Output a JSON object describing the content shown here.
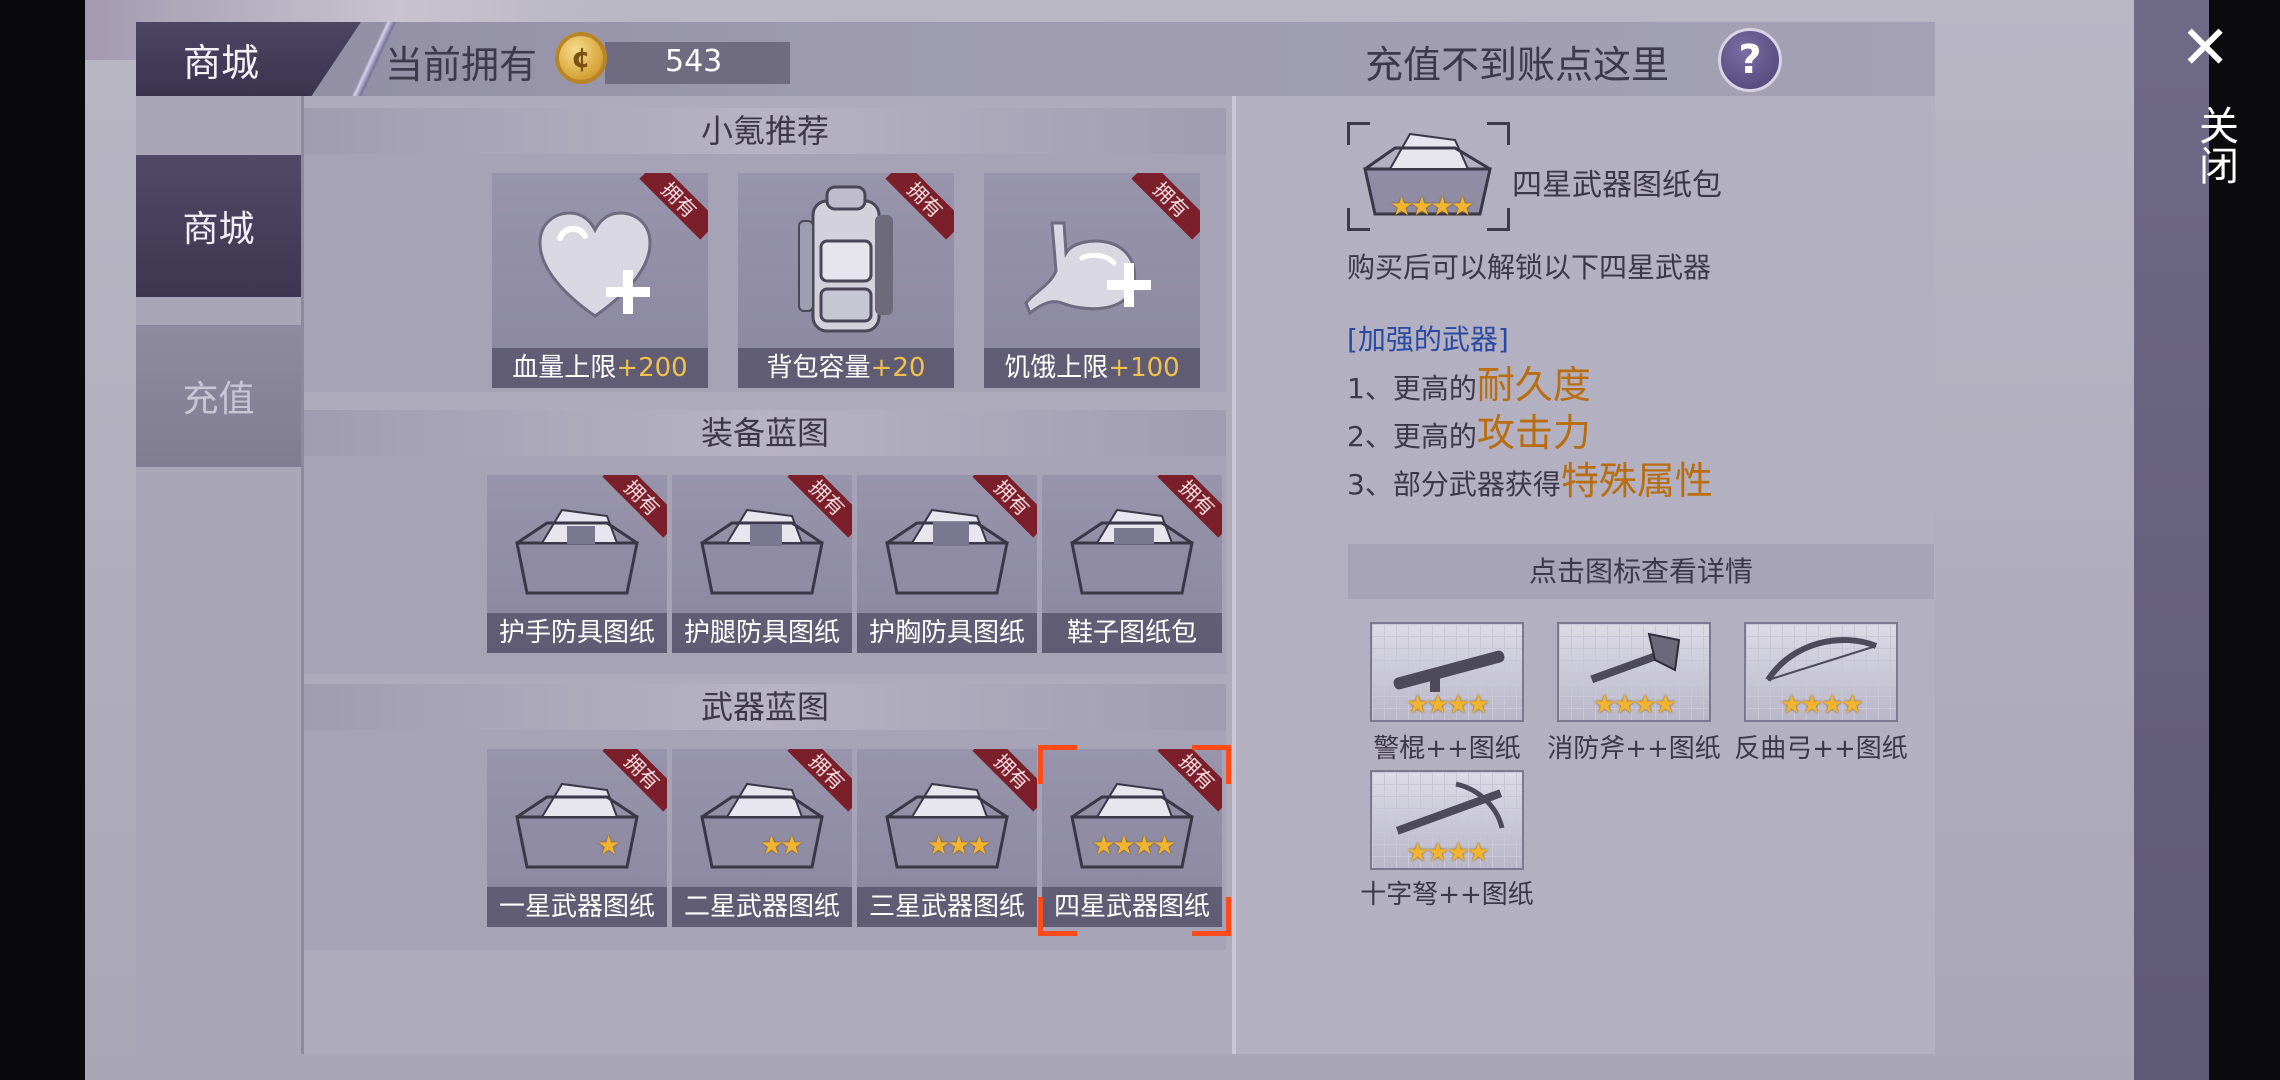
{
  "header": {
    "shop_tab": "商城",
    "owned_label": "当前拥有",
    "coin_glyph": "¢",
    "coin_value": "543",
    "recharge_help": "充值不到账点这里",
    "help_glyph": "?"
  },
  "nav": {
    "items": [
      {
        "label": "商城",
        "active": true
      },
      {
        "label": "充值",
        "active": false
      }
    ]
  },
  "sections": [
    {
      "title": "小氪推荐"
    },
    {
      "title": "装备蓝图"
    },
    {
      "title": "武器蓝图"
    }
  ],
  "owned_badge": "拥有",
  "recommend": [
    {
      "name": "血量上限",
      "bonus": "+200",
      "icon": "heart-plus-icon"
    },
    {
      "name": "背包容量",
      "bonus": "+20",
      "icon": "backpack-icon"
    },
    {
      "name": "饥饿上限",
      "bonus": "+100",
      "icon": "stomach-plus-icon"
    }
  ],
  "equipment": [
    {
      "name": "护手防具图纸",
      "icon": "toolbox-blueprint-icon"
    },
    {
      "name": "护腿防具图纸",
      "icon": "toolbox-blueprint-icon"
    },
    {
      "name": "护胸防具图纸",
      "icon": "toolbox-blueprint-icon"
    },
    {
      "name": "鞋子图纸包",
      "icon": "toolbox-blueprint-icon"
    }
  ],
  "weapons": [
    {
      "name": "一星武器图纸",
      "stars": "★"
    },
    {
      "name": "二星武器图纸",
      "stars": "★★"
    },
    {
      "name": "三星武器图纸",
      "stars": "★★★"
    },
    {
      "name": "四星武器图纸",
      "stars": "★★★★",
      "selected": true
    }
  ],
  "detail": {
    "title": "四星武器图纸包",
    "stars": "★★★★",
    "description": "购买后可以解锁以下四星武器",
    "tag": "[加强的武器]",
    "features": [
      {
        "prefix": "1、更高的",
        "highlight": "耐久度"
      },
      {
        "prefix": "2、更高的",
        "highlight": "攻击力"
      },
      {
        "prefix": "3、部分武器获得",
        "highlight": "特殊属性"
      }
    ],
    "hint": "点击图标查看详情",
    "unlock_items": [
      {
        "name": "警棍++图纸",
        "stars": "★★★★",
        "icon": "baton-icon"
      },
      {
        "name": "消防斧++图纸",
        "stars": "★★★★",
        "icon": "fire-axe-icon"
      },
      {
        "name": "反曲弓++图纸",
        "stars": "★★★★",
        "icon": "recurve-bow-icon"
      },
      {
        "name": "十字弩++图纸",
        "stars": "★★★★",
        "icon": "crossbow-icon"
      }
    ]
  },
  "close": {
    "glyph": "✕",
    "label": "关闭"
  }
}
